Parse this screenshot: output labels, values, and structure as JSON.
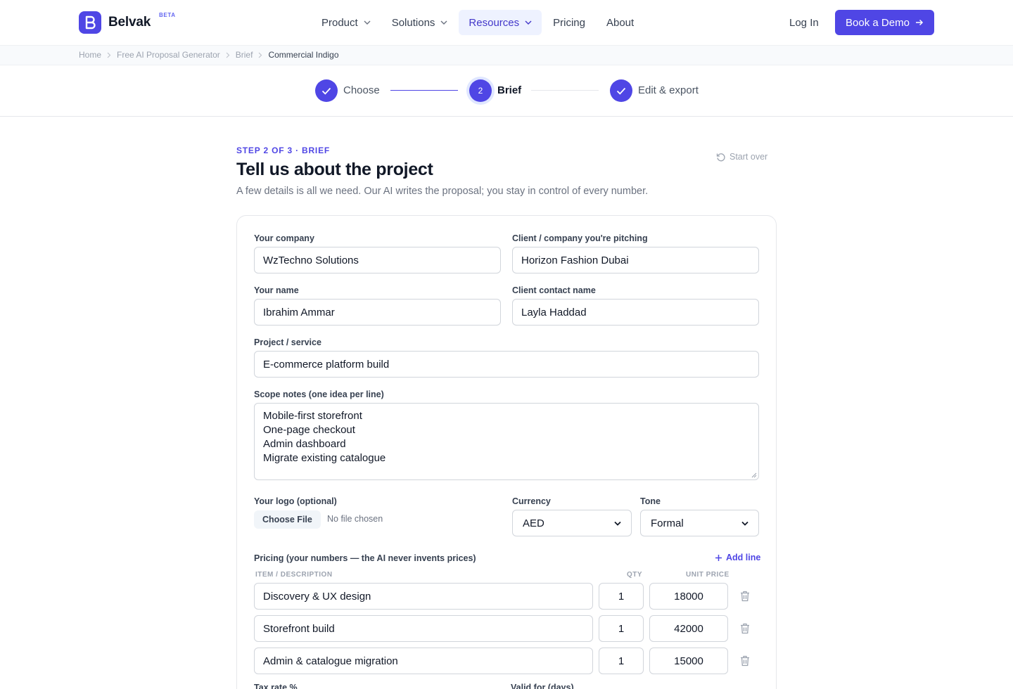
{
  "header": {
    "brand": "Belvak",
    "beta": "BETA",
    "nav": [
      {
        "label": "Product",
        "dropdown": true
      },
      {
        "label": "Solutions",
        "dropdown": true
      },
      {
        "label": "Resources",
        "dropdown": true,
        "active": true
      },
      {
        "label": "Pricing",
        "dropdown": false
      },
      {
        "label": "About",
        "dropdown": false
      }
    ],
    "login": "Log In",
    "demo": "Book a Demo"
  },
  "breadcrumb": [
    "Home",
    "Free AI Proposal Generator",
    "Brief",
    "Commercial Indigo"
  ],
  "stepper": {
    "steps": [
      {
        "label": "Choose",
        "state": "done"
      },
      {
        "label": "Brief",
        "number": "2",
        "state": "current"
      },
      {
        "label": "Edit & export",
        "state": "done"
      }
    ]
  },
  "main": {
    "eyebrow": "STEP 2 OF 3 · BRIEF",
    "title": "Tell us about the project",
    "subtitle": "A few details is all we need. Our AI writes the proposal; you stay in control of every number.",
    "start_over": "Start over"
  },
  "form": {
    "your_company": {
      "label": "Your company",
      "value": "WzTechno Solutions"
    },
    "client_company": {
      "label": "Client / company you're pitching",
      "value": "Horizon Fashion Dubai"
    },
    "your_name": {
      "label": "Your name",
      "value": "Ibrahim Ammar"
    },
    "client_contact": {
      "label": "Client contact name",
      "value": "Layla Haddad"
    },
    "project": {
      "label": "Project / service",
      "value": "E-commerce platform build"
    },
    "scope": {
      "label": "Scope notes (one idea per line)",
      "lines": [
        "Mobile-first storefront",
        "One-page checkout",
        "Admin dashboard",
        "Migrate existing catalogue"
      ]
    },
    "logo": {
      "label": "Your logo (optional)",
      "button": "Choose File",
      "status": "No file chosen"
    },
    "currency": {
      "label": "Currency",
      "value": "AED"
    },
    "tone": {
      "label": "Tone",
      "value": "Formal"
    },
    "pricing": {
      "label": "Pricing (your numbers — the AI never invents prices)",
      "add_line": "Add line",
      "columns": {
        "item": "ITEM / DESCRIPTION",
        "qty": "QTY",
        "unit_price": "UNIT PRICE"
      },
      "items": [
        {
          "description": "Discovery & UX design",
          "qty": "1",
          "unit_price": "18000"
        },
        {
          "description": "Storefront build",
          "qty": "1",
          "unit_price": "42000"
        },
        {
          "description": "Admin & catalogue migration",
          "qty": "1",
          "unit_price": "15000"
        }
      ]
    },
    "tax_rate": {
      "label": "Tax rate %"
    },
    "valid_for": {
      "label": "Valid for (days)"
    }
  },
  "colors": {
    "accent": "#4f46e5",
    "accent_soft": "#eef2ff",
    "border": "#d1d5db",
    "muted": "#6b7280"
  }
}
